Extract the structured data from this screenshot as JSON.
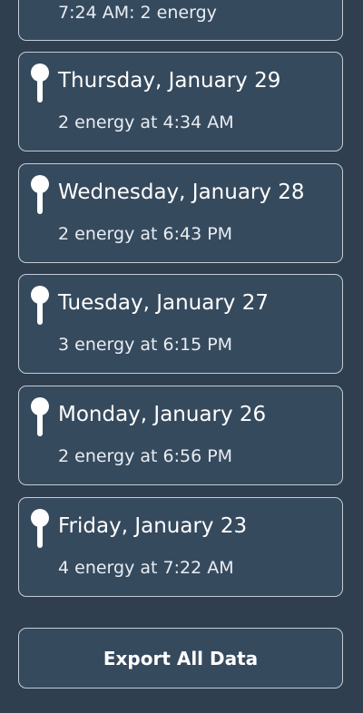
{
  "partial_entry": {
    "text": "7:24 AM: 2 energy"
  },
  "entries": [
    {
      "date": "Thursday, January 29",
      "detail": "2 energy at 4:34 AM",
      "icon": "pin-icon"
    },
    {
      "date": "Wednesday, January 28",
      "detail": "2 energy at 6:43 PM",
      "icon": "pin-icon"
    },
    {
      "date": "Tuesday, January 27",
      "detail": "3 energy at 6:15 PM",
      "icon": "pin-icon"
    },
    {
      "date": "Monday, January 26",
      "detail": "2 energy at 6:56 PM",
      "icon": "pin-icon"
    },
    {
      "date": "Friday, January 23",
      "detail": "4 energy at 7:22 AM",
      "icon": "pin-icon"
    }
  ],
  "export_button": {
    "label": "Export All Data"
  },
  "colors": {
    "background": "#2f3f50",
    "card": "#364a5e",
    "border": "#c3ccd6",
    "text": "#ffffff"
  }
}
